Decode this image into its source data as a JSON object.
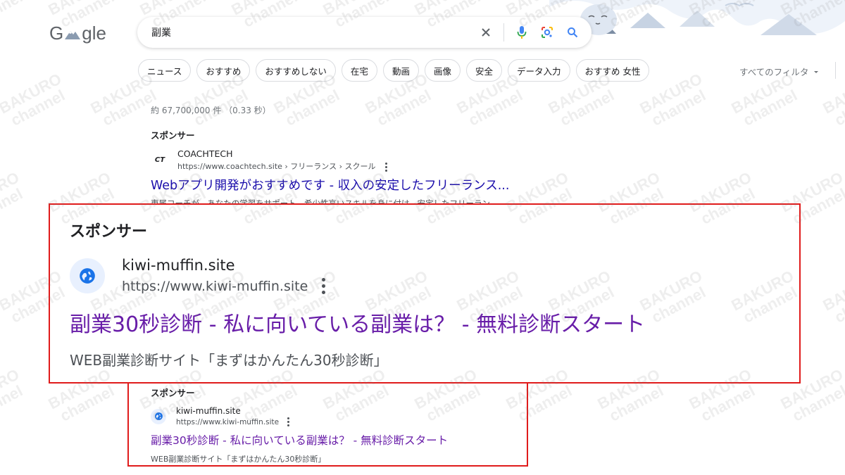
{
  "header": {
    "logo_text_left": "G",
    "logo_text_right": "gle",
    "search_query": "副業"
  },
  "chips": [
    "ニュース",
    "おすすめ",
    "おすすめしない",
    "在宅",
    "動画",
    "画像",
    "安全",
    "データ入力",
    "おすすめ 女性"
  ],
  "all_filters_label": "すべてのフィルタ",
  "results_stats": "約 67,700,000 件 （0.33 秒）",
  "ad_first": {
    "sponsor_label": "スポンサー",
    "favicon_text": "CT",
    "site_name": "COACHTECH",
    "url": "https://www.coachtech.site › フリーランス › スクール",
    "title": "Webアプリ開発がおすすめです - 収入の安定したフリーランス...",
    "description": "専属コーチが、あなたの学習をサポート。希少性高いスキルを身に付け、安定したフリーラン"
  },
  "ad_zoomed": {
    "sponsor_label": "スポンサー",
    "site_name": "kiwi-muffin.site",
    "url": "https://www.kiwi-muffin.site",
    "title": "副業30秒診断 - 私に向いている副業は？ - 無料診断スタート",
    "description": "WEB副業診断サイト「まずはかんたん30秒診断」"
  },
  "ad_second": {
    "sponsor_label": "スポンサー",
    "site_name": "kiwi-muffin.site",
    "url": "https://www.kiwi-muffin.site",
    "title": "副業30秒診断 - 私に向いている副業は？ - 無料診断スタート",
    "description": "WEB副業診断サイト「まずはかんたん30秒診断」"
  },
  "watermark": {
    "line1": "BAKURO",
    "line2": "channel"
  },
  "colors": {
    "highlight_box": "#e01b1b",
    "visited_link": "#681da8",
    "link": "#1a0dab"
  }
}
